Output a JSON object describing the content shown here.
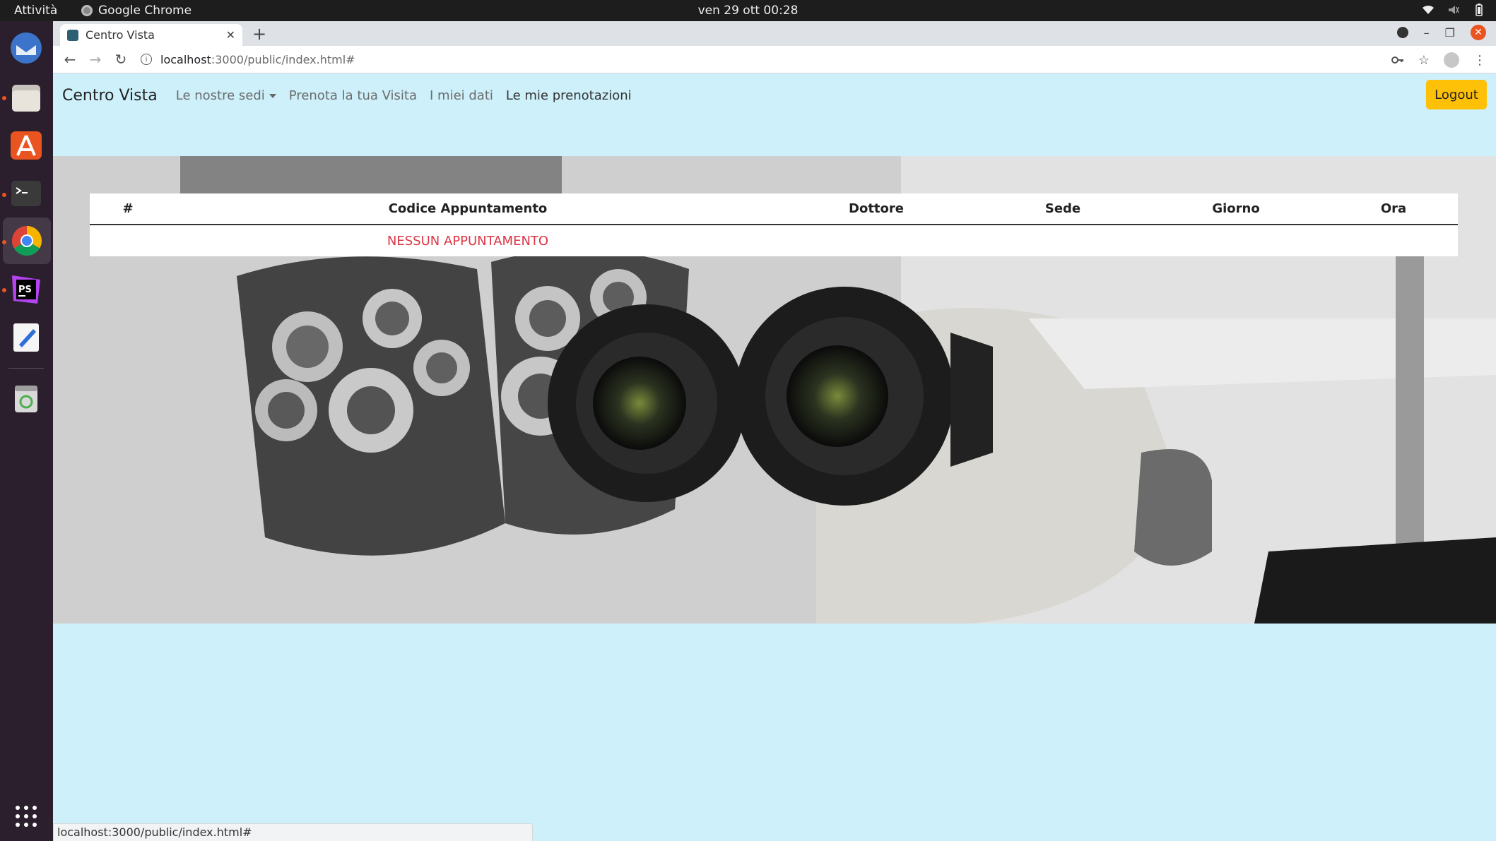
{
  "desktop": {
    "activities": "Attività",
    "app_name": "Google Chrome",
    "clock": "ven 29 ott  00:28"
  },
  "browser": {
    "tab_title": "Centro Vista",
    "url_host": "localhost",
    "url_path": ":3000/public/index.html#",
    "status_url": "localhost:3000/public/index.html#"
  },
  "navbar": {
    "brand": "Centro Vista",
    "links": [
      "Le nostre sedi",
      "Prenota la tua Visita",
      "I miei dati",
      "Le mie prenotazioni"
    ],
    "logout": "Logout"
  },
  "table": {
    "headers": [
      "#",
      "Codice Appuntamento",
      "Dottore",
      "Sede",
      "Giorno",
      "Ora"
    ],
    "empty_message": "NESSUN APPUNTAMENTO"
  },
  "colors": {
    "page_bg": "#cdf0fa",
    "logout_bg": "#ffc107",
    "empty_text": "#dc3545"
  }
}
